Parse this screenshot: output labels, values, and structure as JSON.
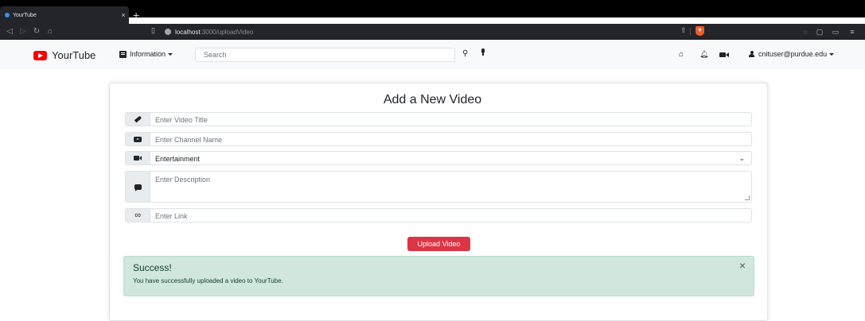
{
  "browser": {
    "tab_title": "YourTube",
    "tab_close": "×",
    "new_tab": "+",
    "url_host": "localhost",
    "url_path": ":3000/uploadVideo"
  },
  "navbar": {
    "brand": "YourTube",
    "info_label": "Information",
    "search_placeholder": "Search",
    "user_email": "cnituser@purdue.edu"
  },
  "form": {
    "title": "Add a New Video",
    "title_placeholder": "Enter Video Title",
    "channel_placeholder": "Enter Channel Name",
    "category_selected": "Entertainment",
    "description_placeholder": "Enter Description",
    "link_placeholder": "Enter Link",
    "upload_label": "Upload Video"
  },
  "alert": {
    "heading": "Success!",
    "message": "You have successfully uploaded a video to YourTube.",
    "close": "×"
  },
  "colors": {
    "brand_red": "#ff0000",
    "button_red": "#dc3545",
    "success_bg": "#d1e7dd"
  }
}
